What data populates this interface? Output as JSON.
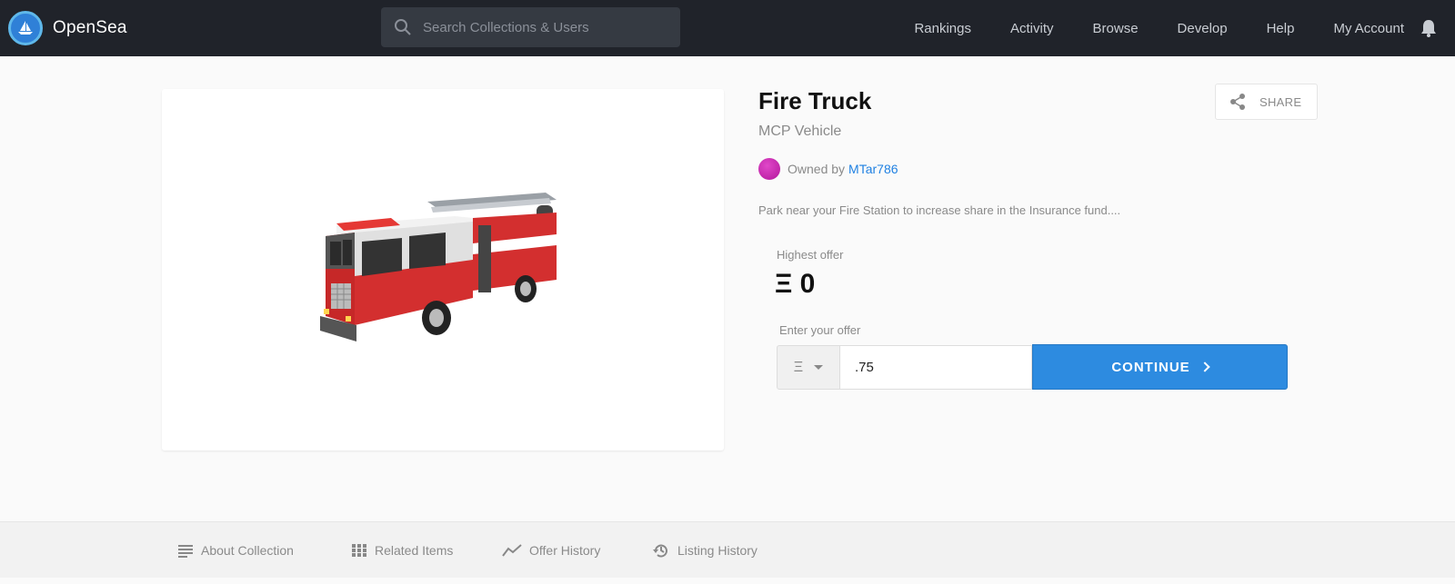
{
  "navbar": {
    "brand": "OpenSea",
    "search_placeholder": "Search Collections & Users",
    "links": [
      "Rankings",
      "Activity",
      "Browse",
      "Develop",
      "Help",
      "My Account"
    ],
    "icons": {
      "logo": "ship-logo-icon",
      "search": "search-icon",
      "notifications": "bell-icon"
    }
  },
  "asset": {
    "title": "Fire Truck",
    "collection": "MCP Vehicle",
    "owned_by_label": "Owned by",
    "owner": "MTar786",
    "description": "Park near your Fire Station to increase share in the Insurance fund....",
    "share_label": "SHARE"
  },
  "offer": {
    "highest_label": "Highest offer",
    "highest_value": "Ξ 0",
    "enter_label": "Enter your offer",
    "currency_symbol": "Ξ",
    "input_value": ".75",
    "continue_label": "CONTINUE"
  },
  "tabs": [
    {
      "label": "About Collection",
      "icon": "list-icon"
    },
    {
      "label": "Related Items",
      "icon": "grid-icon"
    },
    {
      "label": "Offer History",
      "icon": "trend-icon"
    },
    {
      "label": "Listing History",
      "icon": "history-icon"
    }
  ],
  "colors": {
    "nav_bg": "#20232a",
    "accent": "#2d8be0",
    "link": "#2081e2"
  }
}
